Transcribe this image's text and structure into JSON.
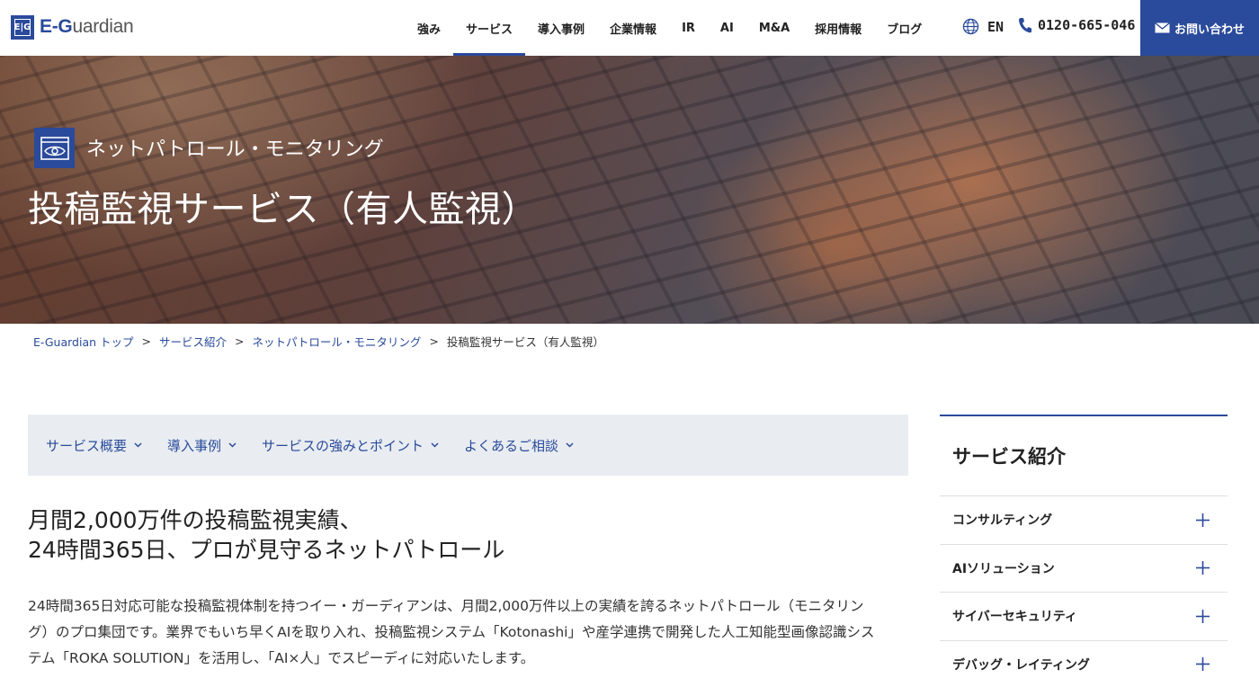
{
  "header": {
    "logo_mark": "E|G",
    "logo_text_a": "E-G",
    "logo_text_b": "uardian",
    "nav": [
      "強み",
      "サービス",
      "導入事例",
      "企業情報",
      "IR",
      "AI",
      "M&A",
      "採用情報",
      "ブログ"
    ],
    "active_nav_index": 1,
    "lang_label": "EN",
    "phone": "0120-665-046",
    "contact_label": "お問い合わせ",
    "accent_color": "#2a4a9b"
  },
  "hero": {
    "category": "ネットパトロール・モニタリング",
    "title": "投稿監視サービス（有人監視）"
  },
  "breadcrumb": [
    "E-Guardian トップ",
    "サービス紹介",
    "ネットパトロール・モニタリング",
    "投稿監視サービス（有人監視）"
  ],
  "tabs": [
    "サービス概要",
    "導入事例",
    "サービスの強みとポイント",
    "よくあるご相談"
  ],
  "main": {
    "headline_line1": "月間2,000万件の投稿監視実績、",
    "headline_line2": "24時間365日、プロが見守るネットパトロール",
    "body_line1": "24時間365日対応可能な投稿監視体制を持つイー・ガーディアンは、月間2,000万件以上の実績を誇るネットパトロール（モニタリン",
    "body_line2": "グ）のプロ集団です。業界でもいち早くAIを取り入れ、投稿監視システム「Kotonashi」や産学連携で開発した人工知能型画像認識シス",
    "body_line3": "テム「ROKA SOLUTION」を活用し、「AI×人」でスピーディに対応いたします。"
  },
  "sidebar": {
    "title": "サービス紹介",
    "items": [
      "コンサルティング",
      "AIソリューション",
      "サイバーセキュリティ",
      "デバッグ・レイティング"
    ]
  }
}
